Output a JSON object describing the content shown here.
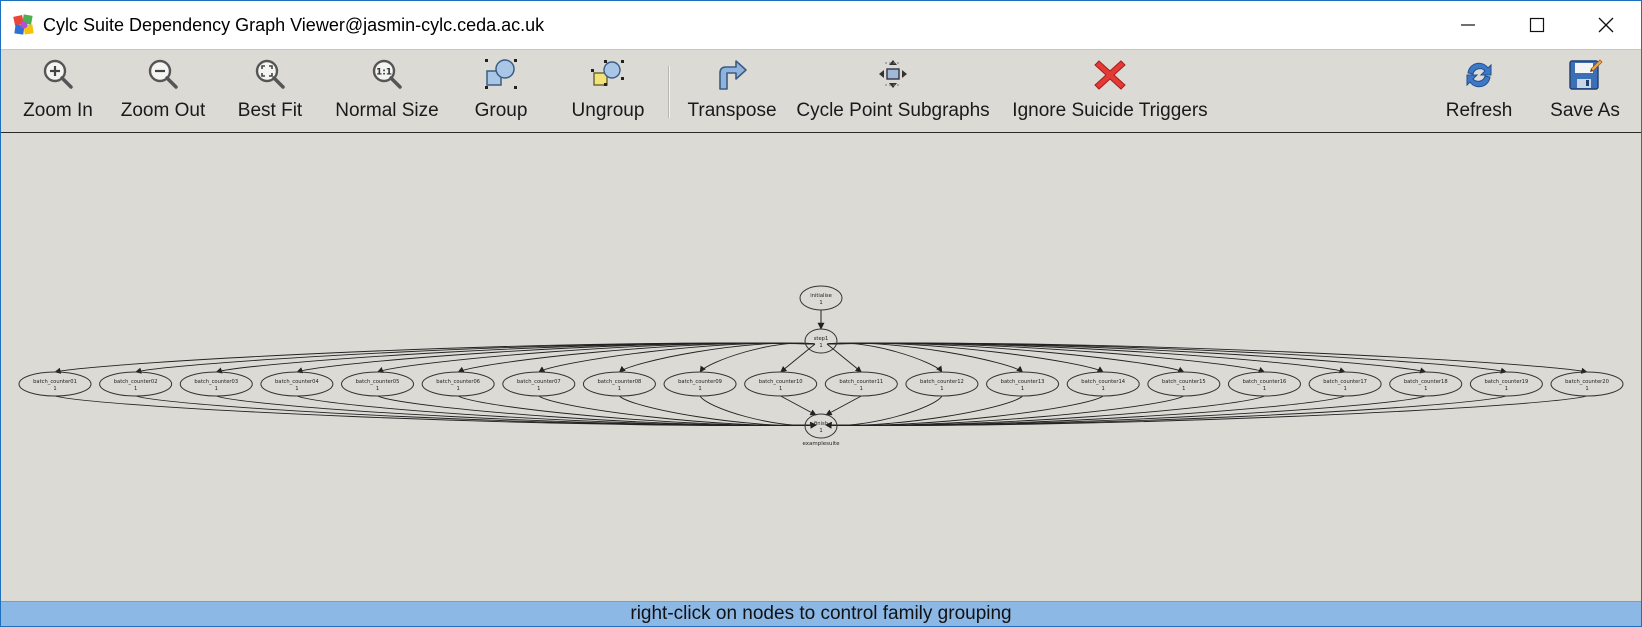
{
  "window": {
    "title": "Cylc Suite Dependency Graph Viewer@jasmin-cylc.ceda.ac.uk",
    "controls": [
      "minimize-icon",
      "maximize-icon",
      "close-icon"
    ]
  },
  "toolbar": {
    "zoom_in": "Zoom In",
    "zoom_out": "Zoom Out",
    "best_fit": "Best Fit",
    "normal_size": "Normal Size",
    "group": "Group",
    "ungroup": "Ungroup",
    "transpose": "Transpose",
    "cycle_point_subgraphs": "Cycle Point Subgraphs",
    "ignore_suicide_triggers": "Ignore Suicide Triggers",
    "refresh": "Refresh",
    "save_as": "Save As"
  },
  "graph": {
    "top_node": {
      "name": "initialise",
      "cycle": "1"
    },
    "hub_node": {
      "name": "step1",
      "cycle": "1"
    },
    "sink_node": {
      "name": "finish",
      "cycle": "1"
    },
    "suite_label": "examplesuite",
    "batch_nodes": [
      {
        "name": "batch_counter01",
        "cycle": "1"
      },
      {
        "name": "batch_counter02",
        "cycle": "1"
      },
      {
        "name": "batch_counter03",
        "cycle": "1"
      },
      {
        "name": "batch_counter04",
        "cycle": "1"
      },
      {
        "name": "batch_counter05",
        "cycle": "1"
      },
      {
        "name": "batch_counter06",
        "cycle": "1"
      },
      {
        "name": "batch_counter07",
        "cycle": "1"
      },
      {
        "name": "batch_counter08",
        "cycle": "1"
      },
      {
        "name": "batch_counter09",
        "cycle": "1"
      },
      {
        "name": "batch_counter10",
        "cycle": "1"
      },
      {
        "name": "batch_counter11",
        "cycle": "1"
      },
      {
        "name": "batch_counter12",
        "cycle": "1"
      },
      {
        "name": "batch_counter13",
        "cycle": "1"
      },
      {
        "name": "batch_counter14",
        "cycle": "1"
      },
      {
        "name": "batch_counter15",
        "cycle": "1"
      },
      {
        "name": "batch_counter16",
        "cycle": "1"
      },
      {
        "name": "batch_counter17",
        "cycle": "1"
      },
      {
        "name": "batch_counter18",
        "cycle": "1"
      },
      {
        "name": "batch_counter19",
        "cycle": "1"
      },
      {
        "name": "batch_counter20",
        "cycle": "1"
      }
    ],
    "colors": {
      "node_stroke": "#333333",
      "edge": "#222222",
      "canvas": "#dcdad5"
    }
  },
  "status": {
    "text": "right-click on nodes to control family grouping"
  },
  "colors": {
    "statusbar": "#8cb8e6",
    "toolbar": "#dcdad5",
    "window_border": "#1f6fbf"
  }
}
